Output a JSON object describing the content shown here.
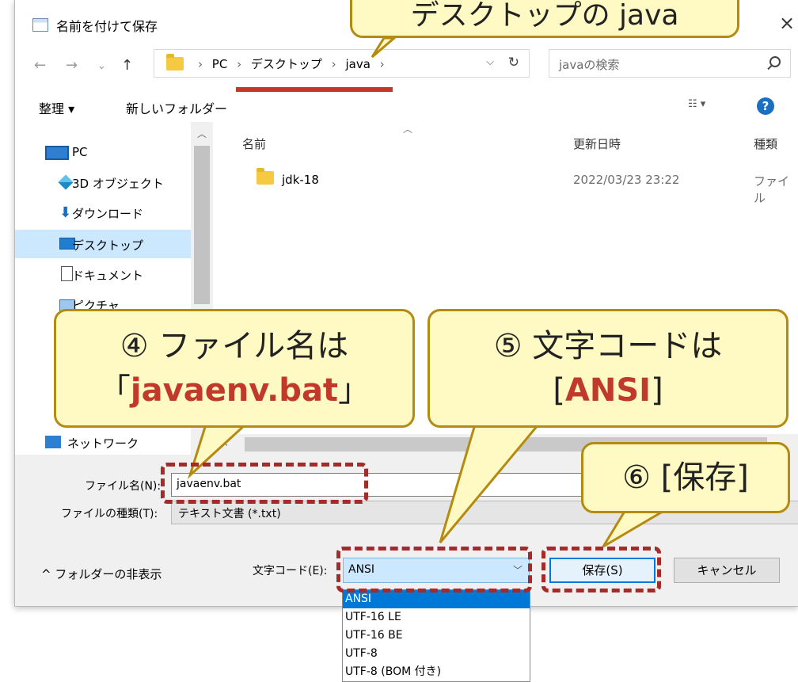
{
  "window": {
    "title": "名前を付けて保存",
    "close": "×"
  },
  "address": {
    "crumbs": [
      "PC",
      "デスクトップ",
      "java"
    ],
    "separator": "›",
    "search_placeholder": "javaの検索"
  },
  "nav_buttons": {
    "back": "←",
    "forward": "→",
    "recent": "⌄",
    "up": "↑"
  },
  "toolbar": {
    "organize": "整理 ▾",
    "new_folder": "新しいフォルダー",
    "view": "☷ ▾",
    "help": "?"
  },
  "sidebar": {
    "items": [
      {
        "label": "PC",
        "icon": "pc-icon"
      },
      {
        "label": "3D オブジェクト",
        "icon": "3d-objects-icon"
      },
      {
        "label": "ダウンロード",
        "icon": "download-icon"
      },
      {
        "label": "デスクトップ",
        "icon": "desktop-icon",
        "selected": true
      },
      {
        "label": "ドキュメント",
        "icon": "documents-icon"
      },
      {
        "label": "ピクチャ",
        "icon": "pictures-icon"
      },
      {
        "label": "ネットワーク",
        "icon": "network-icon"
      }
    ]
  },
  "file_list": {
    "columns": [
      "名前",
      "更新日時",
      "種類"
    ],
    "rows": [
      {
        "name": "jdk-18",
        "modified": "2022/03/23 23:22",
        "type": "ファイル"
      }
    ]
  },
  "form": {
    "filename_label": "ファイル名(N):",
    "filename_value": "javaenv.bat",
    "filetype_label": "ファイルの種類(T):",
    "filetype_value": "テキスト文書 (*.txt)",
    "encoding_label": "文字コード(E):",
    "encoding_value": "ANSI",
    "encoding_options": [
      "ANSI",
      "UTF-16 LE",
      "UTF-16 BE",
      "UTF-8",
      "UTF-8 (BOM 付き)"
    ],
    "save_button": "保存(S)",
    "cancel_button": "キャンセル",
    "hide_folders": "^ フォルダーの非表示"
  },
  "annotations": {
    "top": "デスクトップの java",
    "step4_line1": "④ ファイル名は",
    "step4_open": "「",
    "step4_value": "javaenv.bat",
    "step4_close": "」",
    "step5_line1": "⑤ 文字コードは",
    "step5_open": "[",
    "step5_value": "ANSI",
    "step5_close": "]",
    "step6": "⑥ [保存]"
  },
  "colors": {
    "accent": "#0078d7",
    "callout_bg": "#fff9c4",
    "callout_border": "#b48b10",
    "highlight_red": "#c0392b"
  }
}
